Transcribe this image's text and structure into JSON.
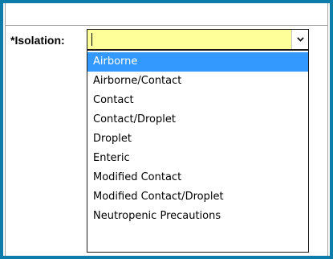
{
  "form": {
    "isolation_label": "*Isolation:",
    "isolation_value": ""
  },
  "dropdown": {
    "selected_index": 0,
    "options": [
      "Airborne",
      "Airborne/Contact",
      "Contact",
      "Contact/Droplet",
      "Droplet",
      "Enteric",
      "Modified Contact",
      "Modified Contact/Droplet",
      "Neutropenic Precautions"
    ]
  },
  "icons": {
    "combo_button": "chevron-down-icon"
  },
  "colors": {
    "window_border": "#0e7cab",
    "input_background": "#ffff99",
    "selection_background": "#3399ff"
  }
}
